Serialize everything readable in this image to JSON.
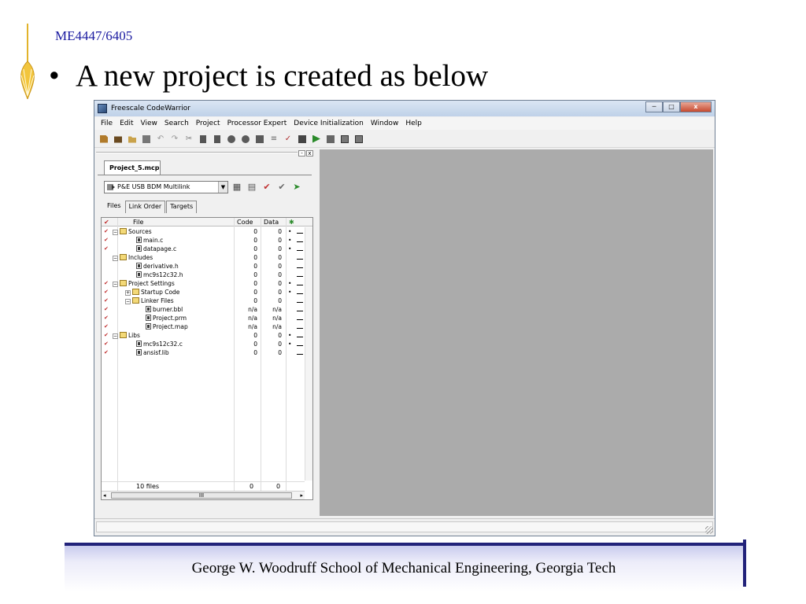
{
  "slide": {
    "course": "ME4447/6405",
    "bullet_symbol": "•",
    "bullet_text": "A new project is created as below",
    "footer": "George W. Woodruff School of Mechanical Engineering, Georgia Tech"
  },
  "window": {
    "title": "Freescale CodeWarrior",
    "minimize": "─",
    "maximize": "□",
    "close": "x",
    "menu": [
      "File",
      "Edit",
      "View",
      "Search",
      "Project",
      "Processor Expert",
      "Device Initialization",
      "Window",
      "Help"
    ]
  },
  "project": {
    "tab": "Project_5.mcp",
    "target": "P&E USB BDM Multilink",
    "subtabs": [
      "Files",
      "Link Order",
      "Targets"
    ],
    "columns": {
      "file": "File",
      "code": "Code",
      "data": "Data"
    },
    "rows": [
      {
        "name": "Sources",
        "code": "0",
        "data": "0",
        "dot": "•",
        "check": "✔"
      },
      {
        "name": "main.c",
        "code": "0",
        "data": "0",
        "dot": "•",
        "check": "✔"
      },
      {
        "name": "datapage.c",
        "code": "0",
        "data": "0",
        "dot": "•",
        "check": "✔"
      },
      {
        "name": "Includes",
        "code": "0",
        "data": "0",
        "dot": "",
        "check": ""
      },
      {
        "name": "derivative.h",
        "code": "0",
        "data": "0",
        "dot": "",
        "check": ""
      },
      {
        "name": "mc9s12c32.h",
        "code": "0",
        "data": "0",
        "dot": "",
        "check": ""
      },
      {
        "name": "Project Settings",
        "code": "0",
        "data": "0",
        "dot": "•",
        "check": "✔"
      },
      {
        "name": "Startup Code",
        "code": "0",
        "data": "0",
        "dot": "•",
        "check": "✔"
      },
      {
        "name": "Linker Files",
        "code": "0",
        "data": "0",
        "dot": "",
        "check": "✔"
      },
      {
        "name": "burner.bbl",
        "code": "n/a",
        "data": "n/a",
        "dot": "",
        "check": "✔"
      },
      {
        "name": "Project.prm",
        "code": "n/a",
        "data": "n/a",
        "dot": "",
        "check": "✔"
      },
      {
        "name": "Project.map",
        "code": "n/a",
        "data": "n/a",
        "dot": "",
        "check": "✔"
      },
      {
        "name": "Libs",
        "code": "0",
        "data": "0",
        "dot": "•",
        "check": "✔"
      },
      {
        "name": "mc9s12c32.c",
        "code": "0",
        "data": "0",
        "dot": "•",
        "check": "✔"
      },
      {
        "name": "ansisf.lib",
        "code": "0",
        "data": "0",
        "dot": "",
        "check": "✔"
      }
    ],
    "footer": {
      "files": "10 files",
      "code": "0",
      "data": "0"
    },
    "hscroll_grip": "III"
  },
  "colors": {
    "course": "#1a1aa0",
    "footer_border": "#22227a",
    "mdi": "#ababab"
  }
}
